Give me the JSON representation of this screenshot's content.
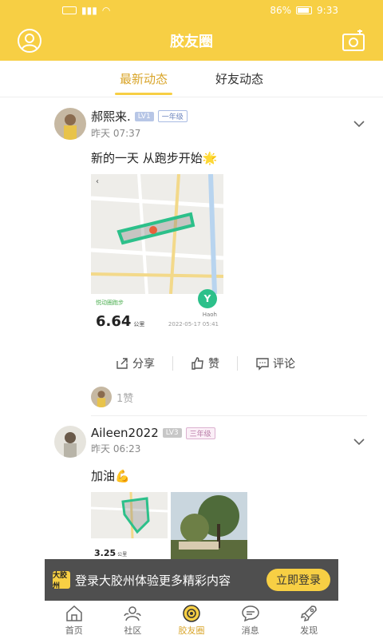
{
  "statusbar": {
    "battery": "86%",
    "time": "9:33"
  },
  "header": {
    "title": "胶友圈"
  },
  "tabs": [
    {
      "label": "最新动态",
      "active": true
    },
    {
      "label": "好友动态",
      "active": false
    }
  ],
  "posts": [
    {
      "name": "郝熙来.",
      "level": "LV1",
      "grade": "一年级",
      "time": "昨天 07:37",
      "text": "新的一天 从跑步开始🌟",
      "run": {
        "distance": "6.64",
        "unit": "公里",
        "date": "2022-05-17 05:41",
        "app": "Haoh",
        "label": "悦动圈跑步"
      },
      "actions": {
        "share": "分享",
        "like": "赞",
        "comment": "评论"
      },
      "likes": "1赞"
    },
    {
      "name": "Aileen2022",
      "level": "LV3",
      "grade": "三年级",
      "time": "昨天 06:23",
      "text": "加油💪",
      "run": {
        "distance": "3.25",
        "unit": "公里"
      }
    }
  ],
  "login_banner": {
    "logo": "大胶州",
    "text": "登录大胶州体验更多精彩内容",
    "button": "立即登录"
  },
  "bottom_nav": [
    {
      "label": "首页",
      "icon": "home-icon",
      "active": false
    },
    {
      "label": "社区",
      "icon": "community-icon",
      "active": false
    },
    {
      "label": "胶友圈",
      "icon": "circle-icon",
      "active": true
    },
    {
      "label": "消息",
      "icon": "message-icon",
      "active": false
    },
    {
      "label": "发现",
      "icon": "discover-icon",
      "active": false
    }
  ],
  "colors": {
    "brand": "#f7cf44",
    "accent": "#d9a52a"
  }
}
